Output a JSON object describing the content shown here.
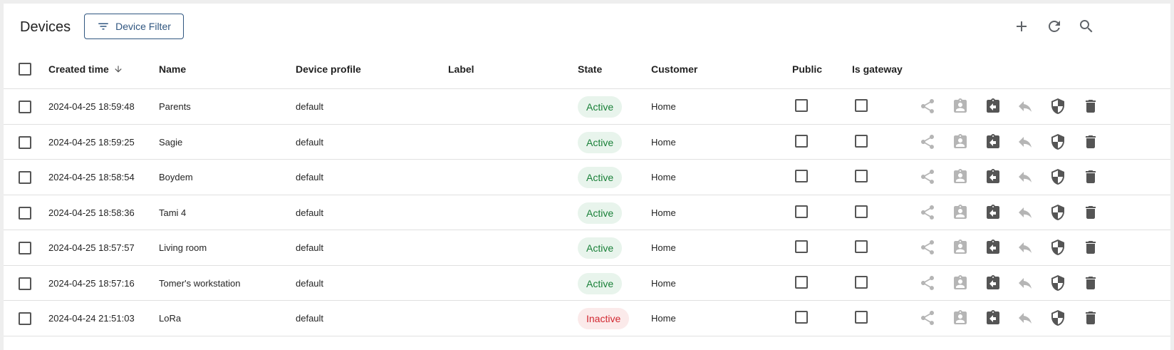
{
  "toolbar": {
    "title": "Devices",
    "filter_label": "Device Filter",
    "icons": [
      "add-icon",
      "refresh-icon",
      "search-icon"
    ]
  },
  "table": {
    "columns": {
      "created_time": "Created time",
      "name": "Name",
      "device_profile": "Device profile",
      "label": "Label",
      "state": "State",
      "customer": "Customer",
      "public": "Public",
      "is_gateway": "Is gateway"
    },
    "sort": {
      "column": "created_time",
      "direction": "descending"
    },
    "rows": [
      {
        "created_time": "2024-04-25 18:59:48",
        "name": "Parents",
        "device_profile": "default",
        "label": "",
        "state": "Active",
        "customer": "Home",
        "public": false,
        "is_gateway": false
      },
      {
        "created_time": "2024-04-25 18:59:25",
        "name": "Sagie",
        "device_profile": "default",
        "label": "",
        "state": "Active",
        "customer": "Home",
        "public": false,
        "is_gateway": false
      },
      {
        "created_time": "2024-04-25 18:58:54",
        "name": "Boydem",
        "device_profile": "default",
        "label": "",
        "state": "Active",
        "customer": "Home",
        "public": false,
        "is_gateway": false
      },
      {
        "created_time": "2024-04-25 18:58:36",
        "name": "Tami 4",
        "device_profile": "default",
        "label": "",
        "state": "Active",
        "customer": "Home",
        "public": false,
        "is_gateway": false
      },
      {
        "created_time": "2024-04-25 18:57:57",
        "name": "Living room",
        "device_profile": "default",
        "label": "",
        "state": "Active",
        "customer": "Home",
        "public": false,
        "is_gateway": false
      },
      {
        "created_time": "2024-04-25 18:57:16",
        "name": "Tomer's workstation",
        "device_profile": "default",
        "label": "",
        "state": "Active",
        "customer": "Home",
        "public": false,
        "is_gateway": false
      },
      {
        "created_time": "2024-04-24 21:51:03",
        "name": "LoRa",
        "device_profile": "default",
        "label": "",
        "state": "Inactive",
        "customer": "Home",
        "public": false,
        "is_gateway": false
      }
    ],
    "row_actions": [
      "share-icon",
      "assign-to-customer-icon",
      "unassign-from-customer-icon",
      "reply-icon",
      "manage-credentials-icon",
      "delete-icon"
    ]
  },
  "colors": {
    "accent": "#305680",
    "active_text": "#198038",
    "active_bg": "#e8f4ec",
    "inactive_text": "#d12730",
    "inactive_bg": "#fbeaea"
  }
}
